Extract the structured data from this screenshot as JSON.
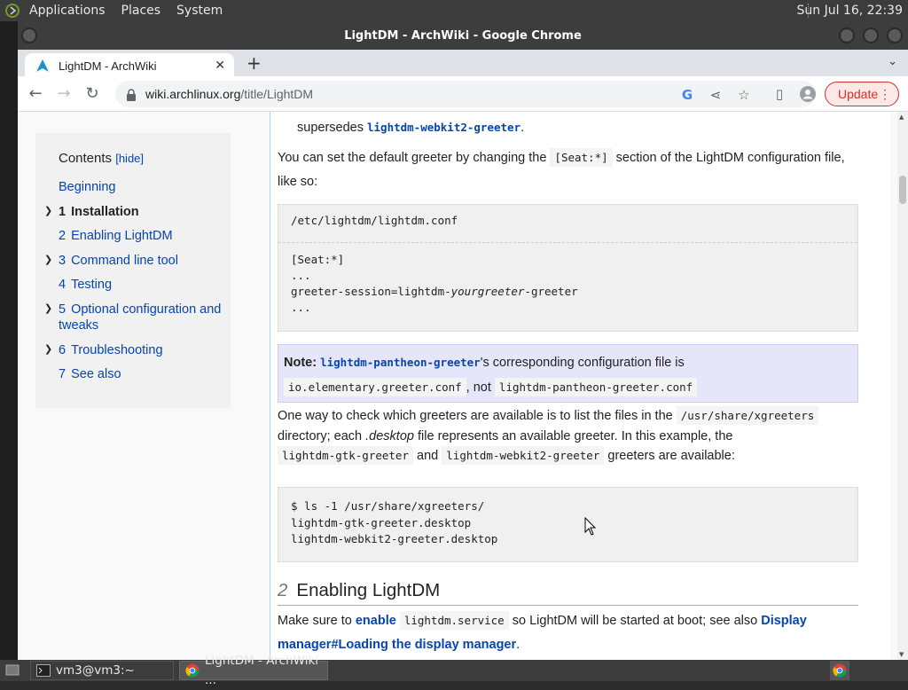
{
  "top_panel": {
    "menus": [
      "Applications",
      "Places",
      "System"
    ],
    "clock": "Sun Jul 16, 22:39"
  },
  "window": {
    "title": "LightDM - ArchWiki - Google Chrome"
  },
  "tab": {
    "title": "LightDM - ArchWiki",
    "close": "✕",
    "new_tab": "+"
  },
  "toolbar": {
    "url_host": "wiki.archlinux.org",
    "url_path": "/title/LightDM",
    "update_label": "Update"
  },
  "toc": {
    "heading": "Contents",
    "hide": "[hide]",
    "items": [
      {
        "num": "",
        "label": "Beginning"
      },
      {
        "num": "1",
        "label": "Installation"
      },
      {
        "num": "2",
        "label": "Enabling LightDM"
      },
      {
        "num": "3",
        "label": "Command line tool"
      },
      {
        "num": "4",
        "label": "Testing"
      },
      {
        "num": "5",
        "label": "Optional configuration and tweaks"
      },
      {
        "num": "6",
        "label": "Troubleshooting"
      },
      {
        "num": "7",
        "label": "See also"
      }
    ]
  },
  "content": {
    "supersedes_text": "supersedes",
    "supersedes_pkg": "lightdm-webkit2-greeter",
    "para1_a": "You can set the default greeter by changing the",
    "para1_code": "[Seat:*]",
    "para1_b": "section of the LightDM configuration file, like so:",
    "code1_file": "/etc/lightdm/lightdm.conf",
    "code1_lines": [
      "[Seat:*]",
      "...",
      "greeter-session=lightdm-",
      "yourgreeter",
      "-greeter",
      "..."
    ],
    "note_label": "Note:",
    "note_pkg": "lightdm-pantheon-greeter",
    "note_text": "'s corresponding configuration file is",
    "note_code1": "io.elementary.greeter.conf",
    "note_not": ", not",
    "note_code2": "lightdm-pantheon-greeter.conf",
    "para2_a": "One way to check which greeters are available is to list the files in the",
    "para2_code": "/usr/share/xgreeters",
    "para2_b": "directory; each",
    "para2_em": ".desktop",
    "para2_c": "file represents an available greeter. In this example, the",
    "para2_code2": "lightdm-gtk-greeter",
    "para2_and": "and",
    "para2_code3": "lightdm-webkit2-greeter",
    "para2_d": "greeters are available:",
    "code2_lines": [
      "$ ls -1 /usr/share/xgreeters/",
      "lightdm-gtk-greeter.desktop",
      "lightdm-webkit2-greeter.desktop"
    ],
    "h2_num": "2",
    "h2_title": "Enabling LightDM",
    "para3_a": "Make sure to",
    "para3_link1": "enable",
    "para3_code": "lightdm.service",
    "para3_b": "so LightDM will be started at boot; see also",
    "para3_link2": "Display manager#Loading the display manager",
    "para3_c": "."
  },
  "taskbar": {
    "items": [
      {
        "label": "vm3@vm3:~"
      },
      {
        "label": "LightDM - ArchWiki ..."
      }
    ]
  }
}
